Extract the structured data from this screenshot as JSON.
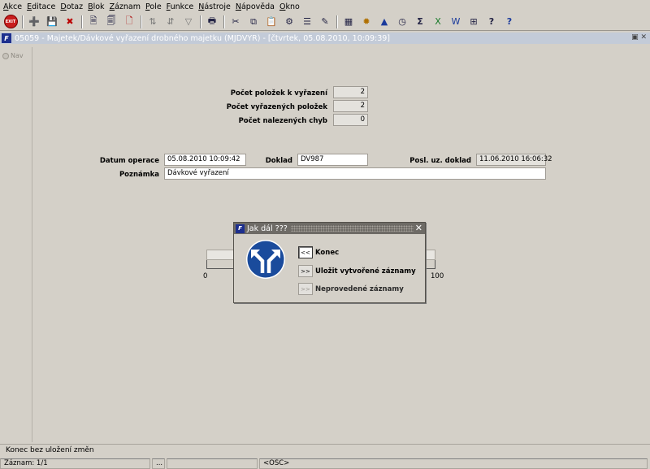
{
  "menu": [
    "Akce",
    "Editace",
    "Dotaz",
    "Blok",
    "Záznam",
    "Pole",
    "Funkce",
    "Nástroje",
    "Nápověda",
    "Okno"
  ],
  "toolbar": {
    "exit_label": "EXIT",
    "group1_icons": [
      "insert-record-icon",
      "save-icon",
      "delete-record-icon"
    ],
    "group2_icons": [
      "new-query-icon",
      "enter-query-icon",
      "execute-query-icon"
    ],
    "group3_icons": [
      "sort-asc-icon",
      "sort-desc-icon",
      "filter-icon"
    ],
    "group4_icons": [
      "print-icon"
    ],
    "group5_icons": [
      "cut-icon",
      "copy-icon",
      "paste-icon",
      "tools-icon",
      "list-icon",
      "edit-icon"
    ],
    "group6_icons": [
      "calculator-icon",
      "settings-icon",
      "warning-icon",
      "clock-icon",
      "sum-icon",
      "excel-icon",
      "word-icon",
      "grid-icon",
      "help-icon",
      "context-help-icon"
    ]
  },
  "window": {
    "title": "05059 - Majetek/Dávkové vyřazení drobného majetku (MJDVYR) - [čtvrtek, 05.08.2010, 10:09:39]",
    "controls": "▣ ✕"
  },
  "nav": {
    "label": "Nav"
  },
  "form": {
    "pocet_polozek_label": "Počet položek k vyřazení",
    "pocet_polozek_value": "2",
    "pocet_vyrazenych_label": "Počet vyřazených položek",
    "pocet_vyrazenych_value": "2",
    "pocet_chyb_label": "Počet nalezených chyb",
    "pocet_chyb_value": "0",
    "datum_label": "Datum operace",
    "datum_value": "05.08.2010 10:09:42",
    "doklad_label": "Doklad",
    "doklad_value": "DV987",
    "posl_doklad_label": "Posl. uz. doklad",
    "posl_doklad_value": "11.06.2010 16:06:32",
    "poznamka_label": "Poznámka",
    "poznamka_value": "Dávkové vyřazení"
  },
  "progress": {
    "min_label": "0",
    "max_label": "100",
    "value": 0
  },
  "dialog": {
    "title": "Jak dál ???",
    "close": "✕",
    "app_logo": "F",
    "icon": "direction-arrows-icon",
    "options": [
      {
        "button": "<<",
        "label": "Konec",
        "state": "pressed"
      },
      {
        "button": ">>",
        "label": "Uložit vytvořené záznamy",
        "state": "normal"
      },
      {
        "button": ">>",
        "label": "Neprovedené záznamy",
        "state": "disabled"
      }
    ]
  },
  "status": {
    "message": "Konec bez uložení změn",
    "record": "Záznam: 1/1",
    "cell2": "...",
    "cell3": "",
    "osc": "<OSC>"
  },
  "colors": {
    "background": "#d4d0c8",
    "title_bar": "#c3cbd8",
    "dialog_title": "#6e6b66",
    "sign_blue": "#1a4b9c",
    "exit_red": "#c81e1e"
  }
}
